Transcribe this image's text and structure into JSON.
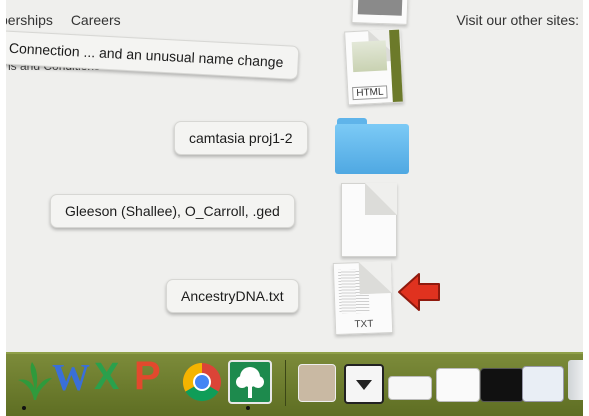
{
  "background_page": {
    "nav_links": [
      "berships",
      "Careers"
    ],
    "other_sites_text": "Visit our other sites:",
    "terms_text": "ns and Conditions"
  },
  "stack": {
    "items": [
      {
        "label": "Connection ... and an unusual name change",
        "icon": "html-file-icon",
        "badge": "HTML"
      },
      {
        "label": "camtasia proj1-2",
        "icon": "folder-icon"
      },
      {
        "label": "Gleeson (Shallee), O_Carroll, .ged",
        "icon": "blank-document-icon"
      },
      {
        "label": "AncestryDNA.txt",
        "icon": "txt-file-icon",
        "badge": "TXT"
      }
    ]
  },
  "annotation": {
    "icon": "red-arrow-icon",
    "color": "#e0321f"
  },
  "dock": {
    "apps": [
      "leaf-app-icon",
      "word-icon",
      "excel-icon",
      "powerpoint-icon",
      "chrome-icon",
      "family-tree-icon"
    ],
    "right_items": [
      "document-stack-icon",
      "downloads-stack-icon",
      "screenshot-thumbnail-icon",
      "calendar-thumbnail-icon",
      "video-thumbnail-icon",
      "finder-window-icon",
      "trash-icon"
    ],
    "colors": {
      "dock": "#6b7b2c"
    }
  }
}
